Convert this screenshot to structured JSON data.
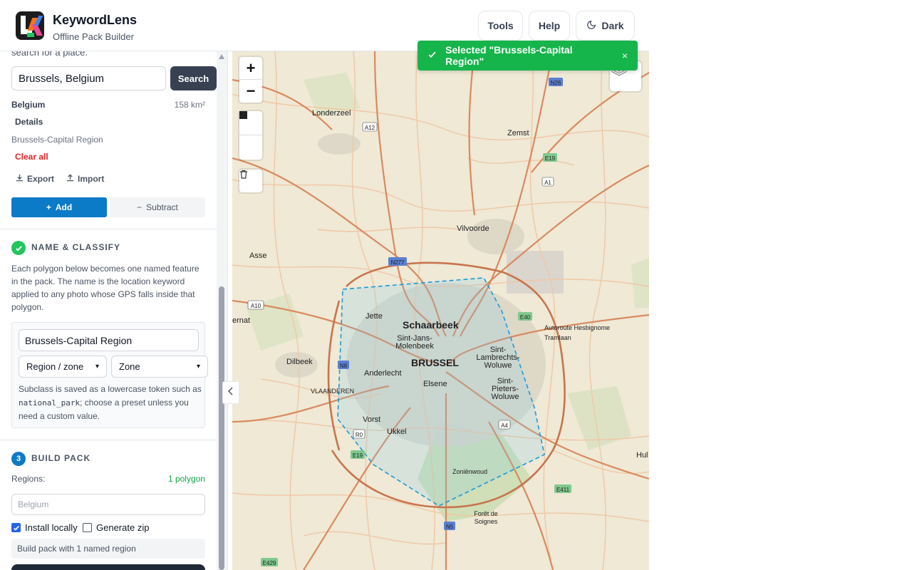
{
  "header": {
    "app_name": "KeywordLens",
    "subtitle": "Offline Pack Builder",
    "tools_label": "Tools",
    "help_label": "Help",
    "dark_label": "Dark"
  },
  "search": {
    "cut_label": "search for a place.",
    "value": "Brussels, Belgium",
    "button_label": "Search",
    "result_country": "Belgium",
    "result_area": "158 km²",
    "details_label": "Details",
    "result_region": "Brussels-Capital Region",
    "clear_label": "Clear all",
    "export_label": "Export",
    "import_label": "Import",
    "add_label": "Add",
    "subtract_label": "Subtract"
  },
  "classify": {
    "title": "NAME & CLASSIFY",
    "description": "Each polygon below becomes one named feature in the pack. The name is the location keyword applied to any photo whose GPS falls inside that polygon.",
    "feature_name": "Brussels-Capital Region",
    "class_value": "Region / zone",
    "subclass_value": "Zone",
    "hint_prefix": "Subclass is saved as a lowercase token such as ",
    "hint_token": "national_park",
    "hint_suffix": "; choose a preset unless you need a custom value."
  },
  "build": {
    "step_number": "3",
    "title": "BUILD PACK",
    "regions_label": "Regions:",
    "regions_count": "1 polygon",
    "pack_placeholder": "Belgium",
    "install_label": "Install locally",
    "install_checked": true,
    "zip_label": "Generate zip",
    "zip_checked": false,
    "summary": "Build pack with 1 named region"
  },
  "toast": {
    "message": "Selected \"Brussels-Capital Region\"",
    "close": "×"
  },
  "map": {
    "labels": {
      "londerzeel": "Londerzeel",
      "zemst": "Zemst",
      "vilvoorde": "Vilvoorde",
      "asse": "Asse",
      "jette": "Jette",
      "schaarbeek": "Schaarbeek",
      "sint_jans_1": "Sint-Jans-",
      "sint_jans_2": "Molenbeek",
      "brussel": "BRUSSEL",
      "anderlecht": "Anderlecht",
      "elsene": "Elsene",
      "sl_1": "Sint-",
      "sl_2": "Lambrechts-",
      "sl_3": "Woluwe",
      "sp_1": "Sint-",
      "sp_2": "Pieters-",
      "sp_3": "Woluwe",
      "dilbeek": "Dilbeek",
      "vorst": "Vorst",
      "ukkel": "Ukkel",
      "zonienwoud": "Zoniënwoud",
      "foret_1": "Forêt de",
      "foret_2": "Soignes",
      "hernat": "ernat",
      "hul": "Hul",
      "tramlaan": "Tramlaan",
      "autoroute": "Autoroute Hesbignome",
      "vlaanderen": "VLAANDEREN"
    },
    "shields": {
      "n26": "N26",
      "a12": "A12",
      "e19_top": "E19",
      "a1": "A1",
      "n277": "N277",
      "a10": "A10",
      "e40": "E40",
      "n8": "N8",
      "r0": "R0",
      "e19_bottom": "E19",
      "a4": "A4",
      "e411": "E411",
      "n5": "N5",
      "e429": "E429"
    },
    "colors": {
      "accent": "#0b7bc7",
      "success": "#16b54b",
      "selection": "#1e9ad6"
    }
  }
}
